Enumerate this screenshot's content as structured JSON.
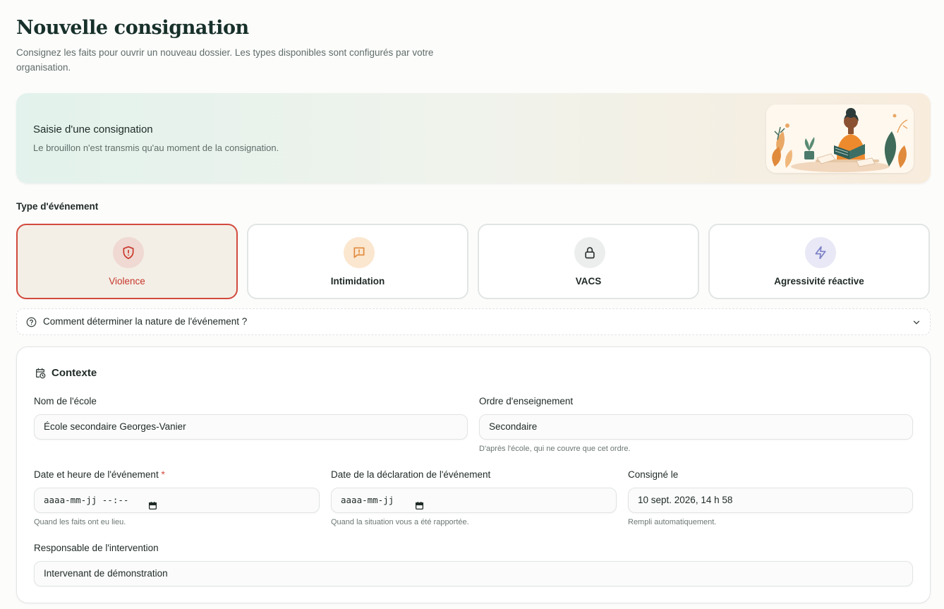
{
  "header": {
    "title": "Nouvelle consignation",
    "subtitle": "Consignez les faits pour ouvrir un nouveau dossier. Les types disponibles sont configurés par votre organisation."
  },
  "hero": {
    "title": "Saisie d'une consignation",
    "text": "Le brouillon n'est transmis qu'au moment de la consignation.",
    "illustration": "woman-reading-illustration"
  },
  "event_type": {
    "label": "Type d'événement",
    "options": [
      {
        "label": "Violence",
        "icon": "shield-alert-icon",
        "selected": true,
        "color": "#d24a3e"
      },
      {
        "label": "Intimidation",
        "icon": "message-alert-icon",
        "selected": false,
        "color": "#e8953a"
      },
      {
        "label": "VACS",
        "icon": "lock-icon",
        "selected": false,
        "color": "#3a403e"
      },
      {
        "label": "Agressivité réactive",
        "icon": "zap-icon",
        "selected": false,
        "color": "#7b7fc6"
      }
    ]
  },
  "help": {
    "text": "Comment déterminer la nature de l'événement ?",
    "icon": "help-circle-icon"
  },
  "context": {
    "title": "Contexte",
    "school": {
      "label": "Nom de l'école",
      "value": "École secondaire Georges-Vanier"
    },
    "order": {
      "label": "Ordre d'enseignement",
      "value": "Secondaire",
      "hint": "D'après l'école, qui ne couvre que cet ordre."
    },
    "event_datetime": {
      "label": "Date et heure de l'événement",
      "required_mark": "*",
      "placeholder": "aaaa-mm-jj --:--",
      "hint": "Quand les faits ont eu lieu."
    },
    "declaration_date": {
      "label": "Date de la déclaration de l'événement",
      "placeholder": "aaaa-mm-jj",
      "hint": "Quand la situation vous a été rapportée."
    },
    "logged_at": {
      "label": "Consigné le",
      "value": "10 sept. 2026, 14 h 58",
      "hint": "Rempli automatiquement."
    },
    "responsible": {
      "label": "Responsable de l'intervention",
      "value": "Intervenant de démonstration"
    }
  },
  "colors": {
    "accent": "#d24a3e",
    "heading": "#17302a",
    "muted": "#5f6d69"
  }
}
